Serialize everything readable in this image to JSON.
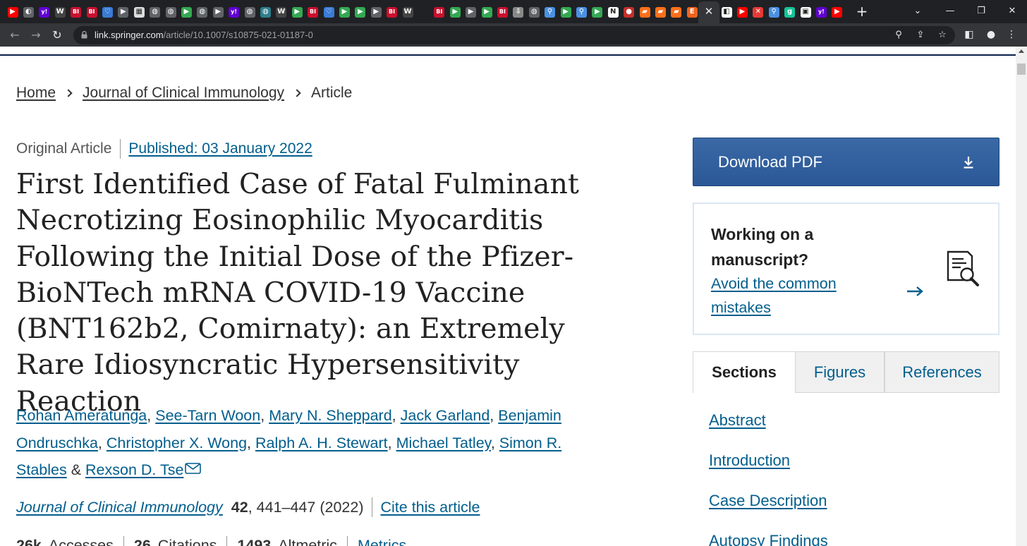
{
  "browser": {
    "favicons": [
      {
        "name": "youtube",
        "color": "#ff0000",
        "glyph": "▶"
      },
      {
        "name": "generic",
        "color": "#5f6368",
        "glyph": "◐"
      },
      {
        "name": "yahoo",
        "color": "#6001d2",
        "glyph": "y!"
      },
      {
        "name": "wsj",
        "color": "#444444",
        "glyph": "W"
      },
      {
        "name": "business-insider",
        "color": "#c8102e",
        "glyph": "BI"
      },
      {
        "name": "business-insider",
        "color": "#c8102e",
        "glyph": "BI"
      },
      {
        "name": "heart",
        "color": "#3a7bd5",
        "glyph": "♡"
      },
      {
        "name": "arrow",
        "color": "#5f6368",
        "glyph": "▶"
      },
      {
        "name": "grid",
        "color": "#dddddd",
        "glyph": "▦"
      },
      {
        "name": "globe",
        "color": "#5f6368",
        "glyph": "◍"
      },
      {
        "name": "globe",
        "color": "#5f6368",
        "glyph": "◍"
      },
      {
        "name": "play",
        "color": "#34a853",
        "glyph": "▶"
      },
      {
        "name": "globe",
        "color": "#5f6368",
        "glyph": "◍"
      },
      {
        "name": "arrow",
        "color": "#5f6368",
        "glyph": "▶"
      },
      {
        "name": "yahoo",
        "color": "#6001d2",
        "glyph": "y!"
      },
      {
        "name": "globe",
        "color": "#5f6368",
        "glyph": "◍"
      },
      {
        "name": "globe-alt",
        "color": "#2d7f8d",
        "glyph": "◍"
      },
      {
        "name": "wsj",
        "color": "#444444",
        "glyph": "W"
      },
      {
        "name": "play",
        "color": "#34a853",
        "glyph": "▶"
      },
      {
        "name": "business-insider",
        "color": "#c8102e",
        "glyph": "BI"
      },
      {
        "name": "heart",
        "color": "#3a7bd5",
        "glyph": "♡"
      },
      {
        "name": "play",
        "color": "#34a853",
        "glyph": "▶"
      },
      {
        "name": "play",
        "color": "#34a853",
        "glyph": "▶"
      },
      {
        "name": "arrow",
        "color": "#5f6368",
        "glyph": "▶"
      },
      {
        "name": "business-insider",
        "color": "#c8102e",
        "glyph": "BI"
      },
      {
        "name": "wsj",
        "color": "#444444",
        "glyph": "W"
      },
      {
        "name": "blank",
        "color": "#202124",
        "glyph": ""
      },
      {
        "name": "business-insider",
        "color": "#c8102e",
        "glyph": "BI"
      },
      {
        "name": "play",
        "color": "#34a853",
        "glyph": "▶"
      },
      {
        "name": "arrow",
        "color": "#5f6368",
        "glyph": "▶"
      },
      {
        "name": "play",
        "color": "#34a853",
        "glyph": "▶"
      },
      {
        "name": "business-insider",
        "color": "#c8102e",
        "glyph": "BI"
      },
      {
        "name": "download",
        "color": "#888888",
        "glyph": "⇩"
      },
      {
        "name": "globe",
        "color": "#5f6368",
        "glyph": "◍"
      },
      {
        "name": "search",
        "color": "#4a90e2",
        "glyph": "⚲"
      },
      {
        "name": "play",
        "color": "#34a853",
        "glyph": "▶"
      },
      {
        "name": "search",
        "color": "#4a90e2",
        "glyph": "⚲"
      },
      {
        "name": "play",
        "color": "#34a853",
        "glyph": "▶"
      },
      {
        "name": "news",
        "color": "#ffffff",
        "glyph": "N"
      },
      {
        "name": "pin",
        "color": "#c4302b",
        "glyph": "●"
      },
      {
        "name": "bookmark",
        "color": "#ff6f1a",
        "glyph": "▰"
      },
      {
        "name": "bookmark",
        "color": "#ff6f1a",
        "glyph": "▰"
      },
      {
        "name": "bookmark",
        "color": "#ff6f1a",
        "glyph": "▰"
      },
      {
        "name": "etsy",
        "color": "#f1641e",
        "glyph": "E"
      }
    ],
    "favicons_after": [
      {
        "name": "lock-page",
        "color": "#ffffff",
        "glyph": "◧"
      },
      {
        "name": "youtube",
        "color": "#ff0000",
        "glyph": "▶"
      },
      {
        "name": "shuffle",
        "color": "#e53935",
        "glyph": "✕"
      },
      {
        "name": "search",
        "color": "#4a90e2",
        "glyph": "⚲"
      },
      {
        "name": "grammarly",
        "color": "#15c39a",
        "glyph": "g"
      },
      {
        "name": "generic",
        "color": "#ffffff",
        "glyph": "▣"
      },
      {
        "name": "yahoo",
        "color": "#6001d2",
        "glyph": "y!"
      },
      {
        "name": "youtube",
        "color": "#ff0000",
        "glyph": "▶"
      }
    ],
    "url_host": "link.springer.com",
    "url_path": "/article/10.1007/s10875-021-01187-0"
  },
  "breadcrumb": {
    "home": "Home",
    "journal": "Journal of Clinical Immunology",
    "current": "Article"
  },
  "article": {
    "type": "Original Article",
    "published": "Published: 03 January 2022",
    "title": "First Identified Case of Fatal Fulminant Necrotizing Eosinophilic Myocarditis Following the Initial Dose of the Pfizer-BioNTech mRNA COVID-19 Vaccine (BNT162b2, Comirnaty): an Extremely Rare Idiosyncratic Hypersensitivity Reaction",
    "authors": [
      "Rohan Ameratunga",
      "See-Tarn Woon",
      "Mary N. Sheppard",
      "Jack Garland",
      "Benjamin Ondruschka",
      "Christopher X. Wong",
      "Ralph A. H. Stewart",
      "Michael Tatley",
      "Simon R. Stables",
      "Rexson D. Tse"
    ],
    "author_joiner": "&",
    "journal_name": "Journal of Clinical Immunology",
    "volume": "42",
    "pages_year": ", 441–447 (2022)",
    "cite": "Cite this article",
    "metrics": [
      {
        "value": "26k",
        "label": "Accesses"
      },
      {
        "value": "26",
        "label": "Citations"
      },
      {
        "value": "1493",
        "label": "Altmetric"
      },
      {
        "value": "",
        "label": "Metrics"
      }
    ]
  },
  "sidebar": {
    "download_pdf": "Download PDF",
    "manuscript_title": "Working on a manuscript?",
    "manuscript_link": "Avoid the common mistakes",
    "tabs": [
      "Sections",
      "Figures",
      "References"
    ],
    "sections": [
      "Abstract",
      "Introduction",
      "Case Description",
      "Autopsy Findings"
    ]
  },
  "colors": {
    "link": "#025e8d",
    "pdf_button": "#2b5796",
    "chrome_dark": "#202124"
  }
}
